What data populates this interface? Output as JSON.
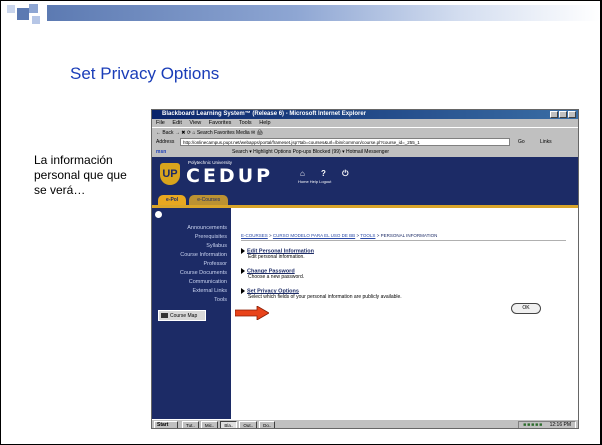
{
  "slide": {
    "title": "Set Privacy Options",
    "side_text": "La información personal que que se verá…",
    "colors": {
      "title": "#1a3db8",
      "bar": "#5c7ab2"
    }
  },
  "browser": {
    "window_title": "Blackboard Learning System™ (Release 6) - Microsoft Internet Explorer",
    "menu": [
      "File",
      "Edit",
      "View",
      "Favorites",
      "Tools",
      "Help"
    ],
    "toolbar_text": "← Back  →  ✖  ⟳  ⌂   Search   Favorites   Media   ✉  🖨",
    "address_label": "Address",
    "address_value": "http://onlinecampus.pupr.net/webapps/portal/frameset.jsp?tab=courses&url=/bin/common/course.pl?course_id=_255_1",
    "go_label": "Go",
    "links_label": "Links",
    "msn_label": "msn",
    "msn_text": "Search ▾   Highlight   Options   Pop-ups Blocked (99) ▾   Hotmail   Messenger"
  },
  "blackboard": {
    "university": "Polytechnic University",
    "brand": "CEDUP",
    "header_icons": "⌂ ? ⏻",
    "header_links": "Home  Help  Logout",
    "tabs": [
      "e-Pol",
      "e-Courses"
    ],
    "nav": [
      "Announcements",
      "Prerequisites",
      "Syllabus",
      "Course Information",
      "Professor",
      "Course Documents",
      "Communication",
      "External Links",
      "Tools"
    ],
    "course_map": "Course Map",
    "breadcrumb": {
      "parts": [
        "E-COURSES",
        "CURSO MODELO PARA EL USO DE BB",
        "TOOLS"
      ],
      "sep": " > ",
      "current": "PERSONAL INFORMATION"
    },
    "items": [
      {
        "label": "Edit Personal Information",
        "desc": "Edit personal information."
      },
      {
        "label": "Change Password",
        "desc": "Choose a new password."
      },
      {
        "label": "Set Privacy Options",
        "desc": "Select which fields of your personal information are publicly available."
      }
    ],
    "ok": "OK"
  },
  "taskbar": {
    "start": "Start",
    "items": [
      "Tut..",
      "Mic..",
      "Bla..",
      "Out..",
      "Do.."
    ],
    "time": "12:16 PM"
  }
}
